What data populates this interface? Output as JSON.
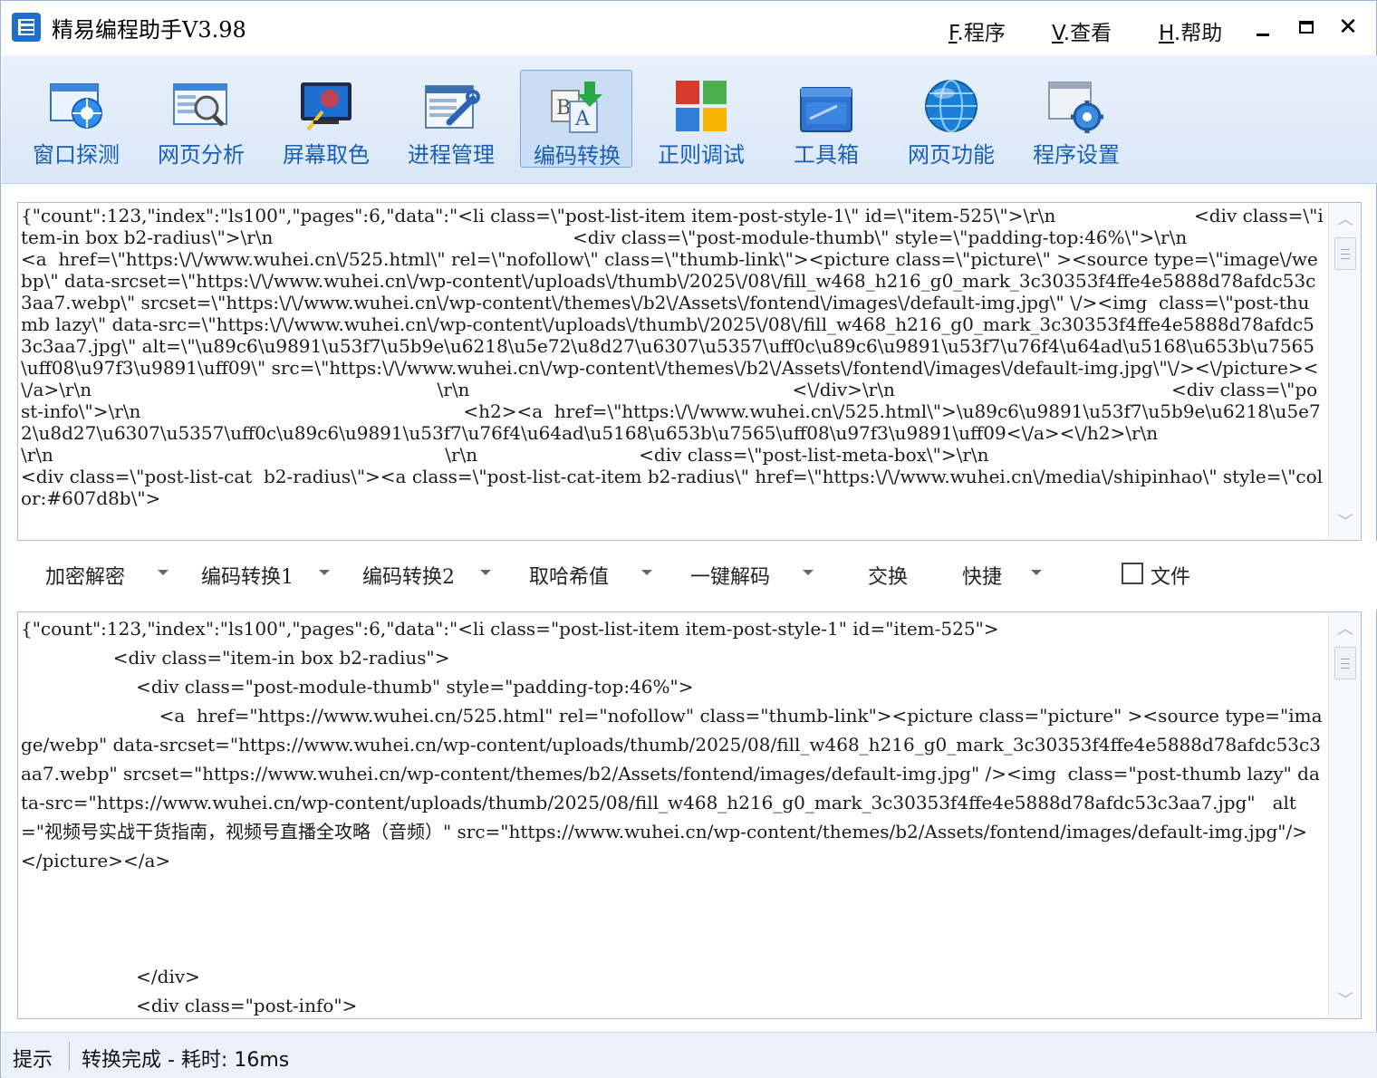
{
  "window": {
    "title": "精易编程助手V3.98",
    "menu": [
      {
        "key": "F",
        "label": ".程序"
      },
      {
        "key": "V",
        "label": ".查看"
      },
      {
        "key": "H",
        "label": ".帮助"
      }
    ],
    "controls": {
      "minimize": "minimize-icon",
      "maximize": "maximize-icon",
      "close": "✕"
    }
  },
  "toolbar": {
    "items": [
      {
        "label": "窗口探测",
        "icon": "window-probe-icon"
      },
      {
        "label": "网页分析",
        "icon": "web-analyze-icon"
      },
      {
        "label": "屏幕取色",
        "icon": "color-picker-icon"
      },
      {
        "label": "进程管理",
        "icon": "process-manager-icon"
      },
      {
        "label": "编码转换",
        "icon": "encoding-convert-icon",
        "active": true
      },
      {
        "label": "正则调试",
        "icon": "regex-debug-icon"
      },
      {
        "label": "工具箱",
        "icon": "toolbox-icon"
      },
      {
        "label": "网页功能",
        "icon": "web-function-icon"
      },
      {
        "label": "程序设置",
        "icon": "settings-icon"
      }
    ]
  },
  "input_pane": {
    "text": "{\"count\":123,\"index\":\"ls100\",\"pages\":6,\"data\":\"<li class=\\\"post-list-item item-post-style-1\\\" id=\\\"item-525\\\">\\r\\n                        <div class=\\\"item-in box b2-radius\\\">\\r\\n                                                    <div class=\\\"post-module-thumb\\\" style=\\\"padding-top:46%\\\">\\r\\n                                                                <a  href=\\\"https:\\/\\/www.wuhei.cn\\/525.html\\\" rel=\\\"nofollow\\\" class=\\\"thumb-link\\\"><picture class=\\\"picture\\\" ><source type=\\\"image\\/webp\\\" data-srcset=\\\"https:\\/\\/www.wuhei.cn\\/wp-content\\/uploads\\/thumb\\/2025\\/08\\/fill_w468_h216_g0_mark_3c30353f4ffe4e5888d78afdc53c3aa7.webp\\\" srcset=\\\"https:\\/\\/www.wuhei.cn\\/wp-content\\/themes\\/b2\\/Assets\\/fontend\\/images\\/default-img.jpg\\\" \\/><img  class=\\\"post-thumb lazy\\\" data-src=\\\"https:\\/\\/www.wuhei.cn\\/wp-content\\/uploads\\/thumb\\/2025\\/08\\/fill_w468_h216_g0_mark_3c30353f4ffe4e5888d78afdc53c3aa7.jpg\\\" alt=\\\"\\u89c6\\u9891\\u53f7\\u5b9e\\u6218\\u5e72\\u8d27\\u6307\\u5357\\uff0c\\u89c6\\u9891\\u53f7\\u76f4\\u64ad\\u5168\\u653b\\u7565\\uff08\\u97f3\\u9891\\uff09\\\" src=\\\"https:\\/\\/www.wuhei.cn\\/wp-content\\/themes\\/b2\\/Assets\\/fontend\\/images\\/default-img.jpg\\\"\\/><\\/picture><\\/a>\\r\\n                                                            \\r\\n                                                        <\\/div>\\r\\n                                                <div class=\\\"post-info\\\">\\r\\n                                                        <h2><a  href=\\\"https:\\/\\/www.wuhei.cn\\/525.html\\\">\\u89c6\\u9891\\u53f7\\u5b9e\\u6218\\u5e72\\u8d27\\u6307\\u5357\\uff0c\\u89c6\\u9891\\u53f7\\u76f4\\u64ad\\u5168\\u653b\\u7565\\uff08\\u97f3\\u9891\\uff09<\\/a><\\/h2>\\r\\n                                                            \\r\\n                                                                    \\r\\n                            <div class=\\\"post-list-meta-box\\\">\\r\\n                                                                <div class=\\\"post-list-cat  b2-radius\\\"><a class=\\\"post-list-cat-item b2-radius\\\" href=\\\"https:\\/\\/www.wuhei.cn\\/media\\/shipinhao\\\" style=\\\"color:#607d8b\\\">"
  },
  "middle_bar": {
    "buttons": [
      {
        "label": "加密解密",
        "dropdown": true
      },
      {
        "label": "编码转换1",
        "dropdown": true
      },
      {
        "label": "编码转换2",
        "dropdown": true
      },
      {
        "label": "取哈希值",
        "dropdown": true
      },
      {
        "label": "一键解码",
        "dropdown": true
      },
      {
        "label": "交换",
        "dropdown": false
      },
      {
        "label": "快捷",
        "dropdown": true
      }
    ],
    "file_checkbox": {
      "label": "文件",
      "checked": false
    }
  },
  "output_pane": {
    "text": "{\"count\":123,\"index\":\"ls100\",\"pages\":6,\"data\":\"<li class=\"post-list-item item-post-style-1\" id=\"item-525\">\n                <div class=\"item-in box b2-radius\">\n                    <div class=\"post-module-thumb\" style=\"padding-top:46%\">\n                        <a  href=\"https://www.wuhei.cn/525.html\" rel=\"nofollow\" class=\"thumb-link\"><picture class=\"picture\" ><source type=\"image/webp\" data-srcset=\"https://www.wuhei.cn/wp-content/uploads/thumb/2025/08/fill_w468_h216_g0_mark_3c30353f4ffe4e5888d78afdc53c3aa7.webp\" srcset=\"https://www.wuhei.cn/wp-content/themes/b2/Assets/fontend/images/default-img.jpg\" /><img  class=\"post-thumb lazy\" data-src=\"https://www.wuhei.cn/wp-content/uploads/thumb/2025/08/fill_w468_h216_g0_mark_3c30353f4ffe4e5888d78afdc53c3aa7.jpg\"   alt=\"视频号实战干货指南，视频号直播全攻略（音频）\" src=\"https://www.wuhei.cn/wp-content/themes/b2/Assets/fontend/images/default-img.jpg\"/></picture></a>\n\n\n\n                    </div>\n                    <div class=\"post-info\">"
  },
  "status_bar": {
    "hint_label": "提示",
    "message": "转换完成 - 耗时: 16ms"
  },
  "colors": {
    "accent": "#1a5fb4",
    "toolbar_bg": "#dfeaf7",
    "status_bg": "#eaf1f9"
  }
}
